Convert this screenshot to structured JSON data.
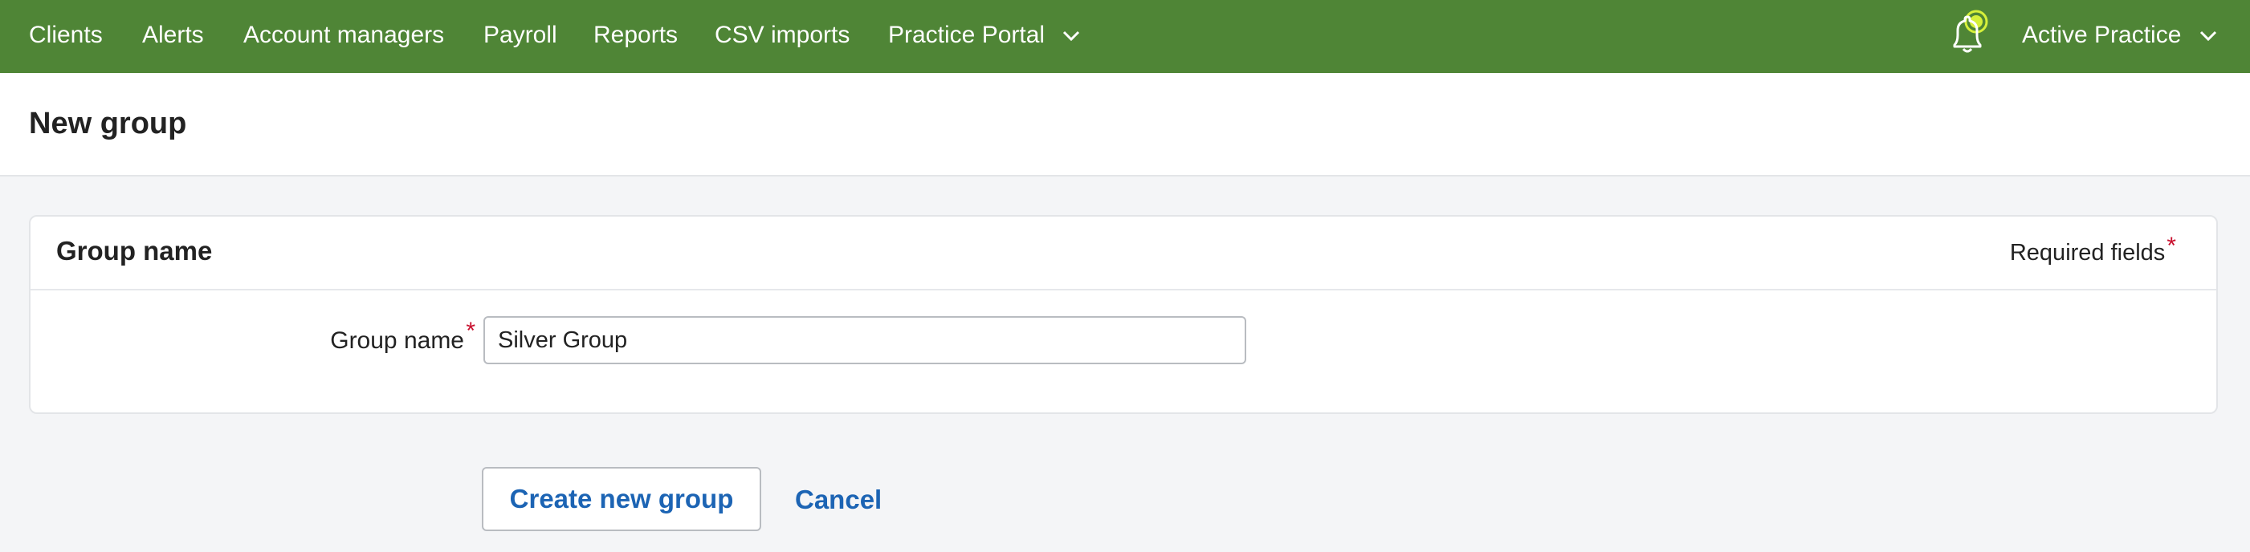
{
  "nav": {
    "items": [
      "Clients",
      "Alerts",
      "Account managers",
      "Payroll",
      "Reports",
      "CSV imports"
    ],
    "portal_label": "Practice Portal",
    "account_label": "Active Practice",
    "icons": {
      "notifications": "bell-icon",
      "dropdown": "chevron-down-icon"
    },
    "colors": {
      "bar": "#4f8536",
      "bell_highlight": "#d6f03a"
    }
  },
  "page": {
    "title": "New group"
  },
  "card": {
    "title": "Group name",
    "required_note": "Required fields",
    "field_label": "Group name",
    "required_marker": "*",
    "input_value": "Silver Group"
  },
  "actions": {
    "create_label": "Create new group",
    "cancel_label": "Cancel",
    "link_color": "#1c64b4"
  }
}
